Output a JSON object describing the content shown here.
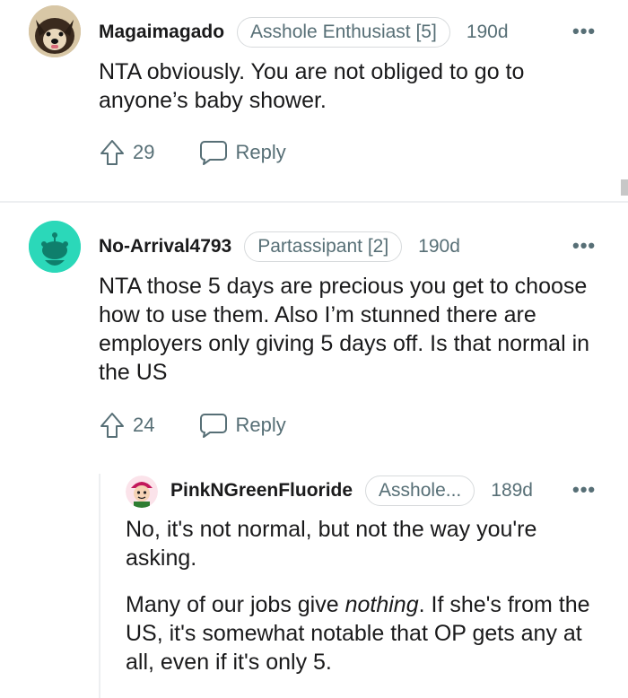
{
  "comments": [
    {
      "username": "Magaimagado",
      "flair": "Asshole Enthusiast [5]",
      "age": "190d",
      "body": [
        "NTA obviously. You are not obliged to go to anyone’s baby shower."
      ],
      "votes": "29",
      "reply_label": "Reply",
      "avatar_icon": "dog-avatar-icon"
    },
    {
      "username": "No-Arrival4793",
      "flair": "Partassipant [2]",
      "age": "190d",
      "body": [
        "NTA those 5 days are precious you get to choose how to use them. Also I’m stunned there are employers only giving 5 days off. Is that normal in the US"
      ],
      "votes": "24",
      "reply_label": "Reply",
      "avatar_icon": "snoo-avatar-icon"
    },
    {
      "username": "PinkNGreenFluoride",
      "flair": "Asshole...",
      "age": "189d",
      "body_p1": "No, it's not normal, but not the way you're asking.",
      "body_p2_pre": "Many of our jobs give ",
      "body_p2_em": "nothing",
      "body_p2_post": ". If she's from the US, it's somewhat notable that OP gets any at all, even if it's only 5.",
      "avatar_icon": "cartoon-avatar-icon"
    }
  ],
  "more_glyph": "•••",
  "colors": {
    "text": "#1a1a1b",
    "meta": "#576f76",
    "divider": "#edeff1",
    "snoo": "#2bd8b9"
  }
}
